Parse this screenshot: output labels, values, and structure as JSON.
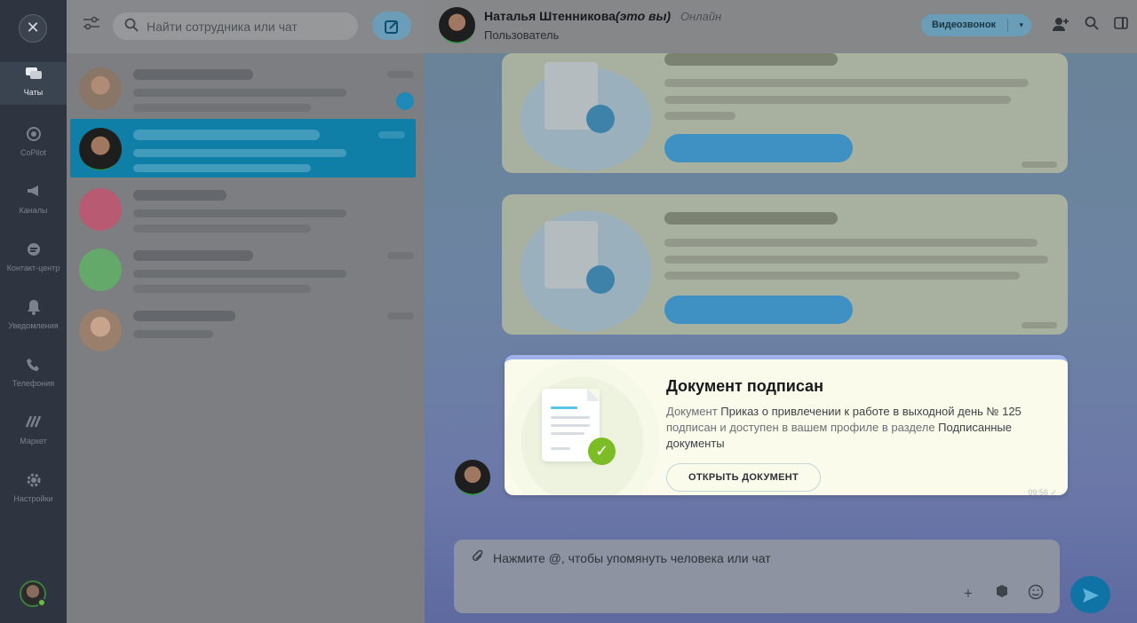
{
  "rail": {
    "close_icon": "✕",
    "items": [
      {
        "label": "Чаты",
        "icon": "chat-bubbles-icon"
      },
      {
        "label": "CoPilot",
        "icon": "copilot-icon"
      },
      {
        "label": "Каналы",
        "icon": "megaphone-icon"
      },
      {
        "label": "Контакт-центр",
        "icon": "contact-center-icon"
      },
      {
        "label": "Уведомления",
        "icon": "bell-icon"
      },
      {
        "label": "Телефония",
        "icon": "phone-icon"
      },
      {
        "label": "Маркет",
        "icon": "market-icon"
      },
      {
        "label": "Настройки",
        "icon": "gear-icon"
      }
    ]
  },
  "search": {
    "placeholder": "Найти сотрудника или чат"
  },
  "chat_header": {
    "name": "Наталья Штенникова",
    "you_note": "(это вы)",
    "status": "Онлайн",
    "role": "Пользователь",
    "video_call_label": "Видеозвонок"
  },
  "signed_card": {
    "title": "Документ подписан",
    "text_prefix": "Документ ",
    "doc_name": "Приказ о привлечении к работе в выходной день № 125",
    "text_middle": " подписан и доступен в вашем профиле в разделе ",
    "section": "Подписанные документы",
    "button_label": "ОТКРЫТЬ ДОКУМЕНТ",
    "time": "09:56"
  },
  "composer": {
    "placeholder": "Нажмите @, чтобы упомянуть человека или чат"
  },
  "colors": {
    "accent": "#0f7fa8",
    "success": "#7cbd26"
  }
}
